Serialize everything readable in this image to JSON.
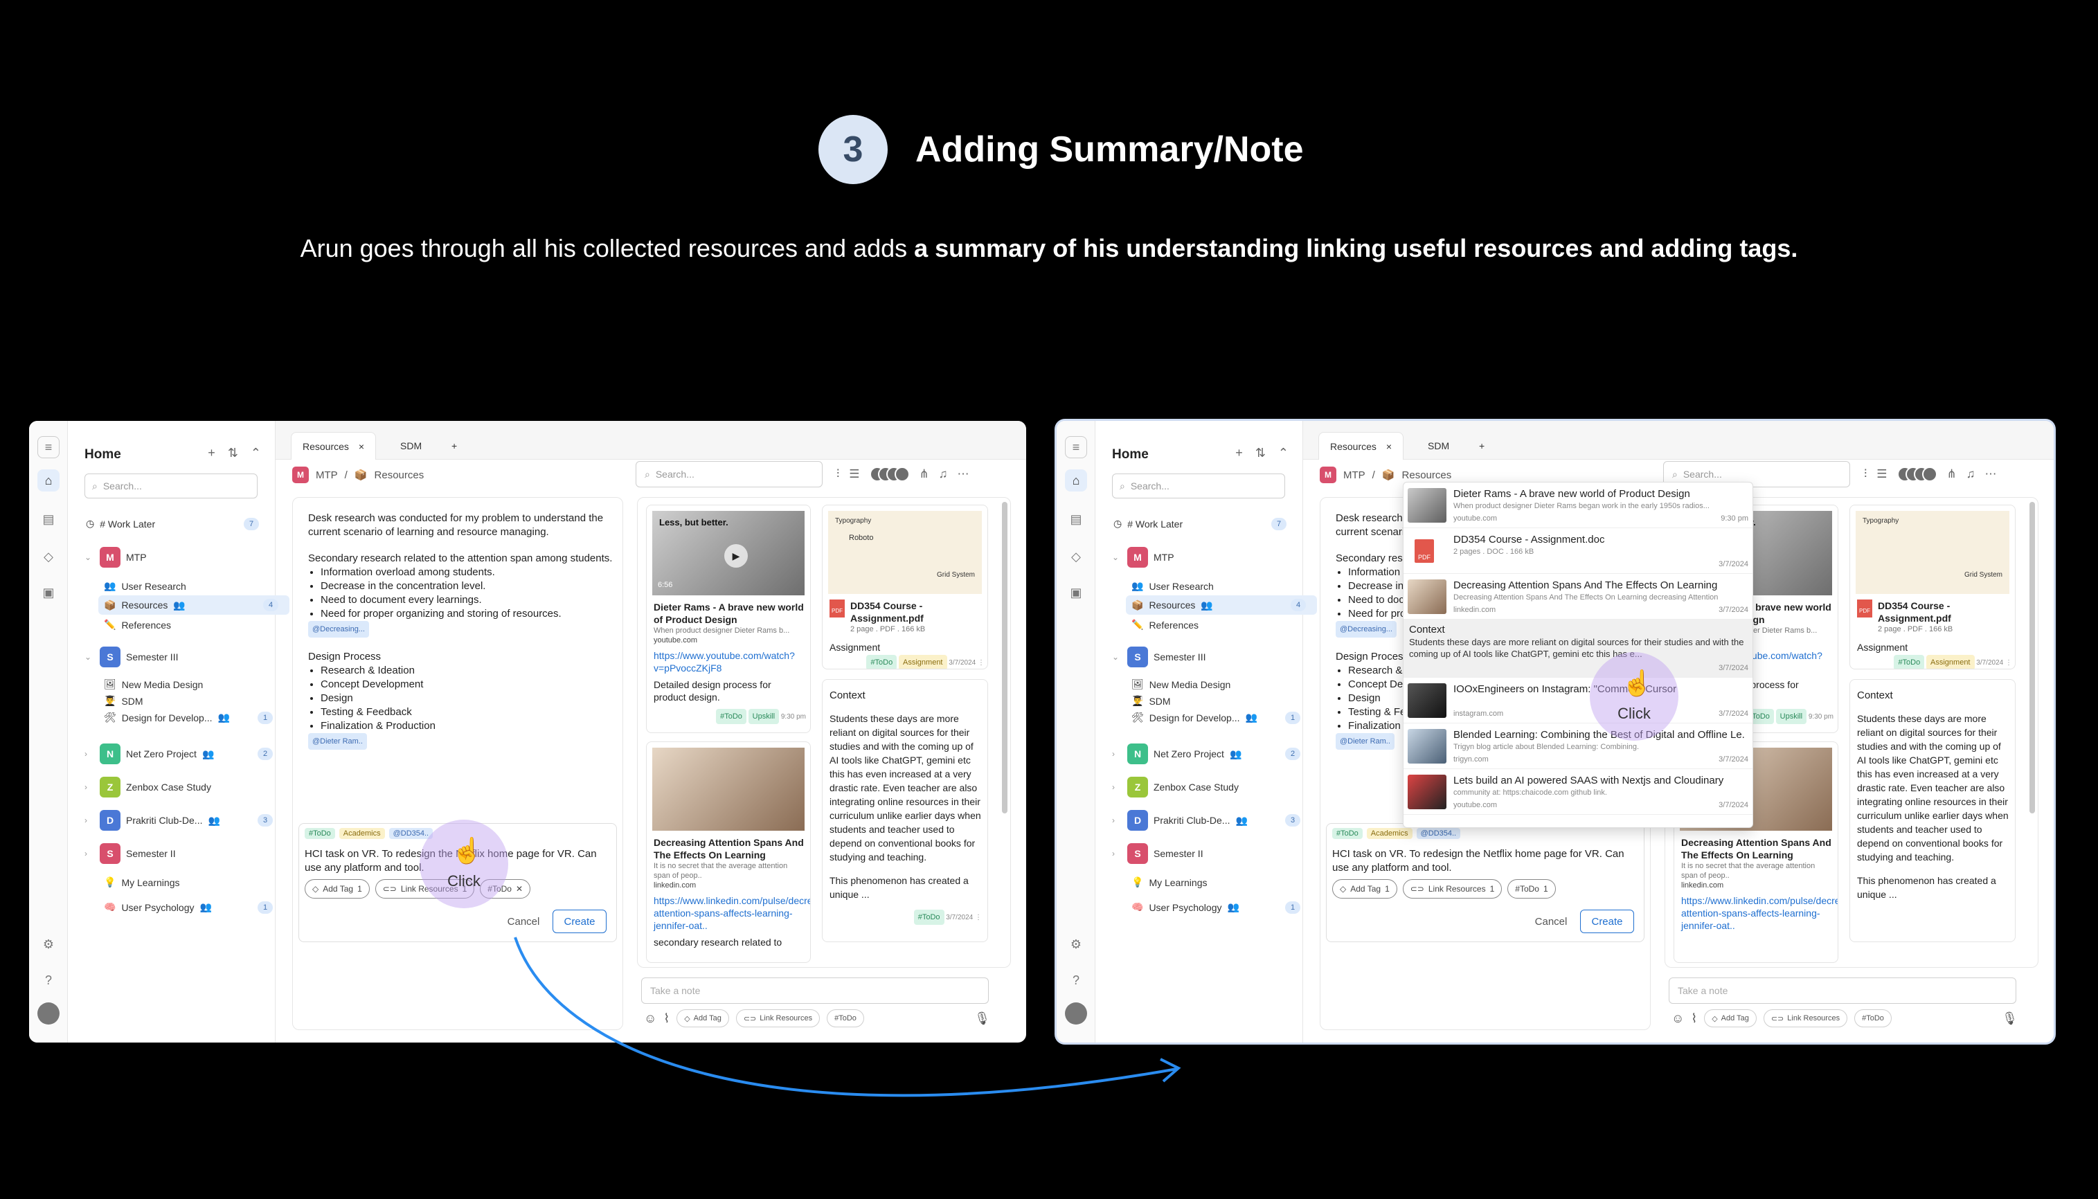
{
  "header": {
    "step_number": "3",
    "title": "Adding Summary/Note",
    "subtitle_plain": "Arun goes through all his collected resources and adds ",
    "subtitle_bold": "a summary of his understanding linking useful resources and adding tags."
  },
  "sidebar": {
    "title": "Home",
    "search_placeholder": "Search...",
    "work_later": "# Work Later",
    "work_later_count": "7",
    "mtp": {
      "label": "MTP",
      "avatar": "M"
    },
    "mtp_children": [
      {
        "label": "User Research",
        "icon": "👥"
      },
      {
        "label": "Resources",
        "icon": "📦",
        "count": "4"
      },
      {
        "label": "References",
        "icon": "✏️"
      }
    ],
    "sem3": {
      "label": "Semester III",
      "avatar": "S"
    },
    "sem3_children": [
      {
        "label": "New Media Design",
        "icon": "🖼"
      },
      {
        "label": "SDM",
        "icon": "👨‍🎓"
      },
      {
        "label": "Design for Develop...",
        "icon": "🛠",
        "count": "1"
      }
    ],
    "others": [
      {
        "label": "Net Zero Project",
        "avatar": "N",
        "count": "2"
      },
      {
        "label": "Zenbox Case Study",
        "avatar": "Z"
      },
      {
        "label": "Prakriti Club-De...",
        "avatar": "D",
        "count": "3"
      },
      {
        "label": "Semester II",
        "avatar": "S"
      }
    ],
    "my_learnings": "My Learnings",
    "user_psychology": "User Psychology",
    "user_psychology_count": "1"
  },
  "tabs": [
    {
      "label": "Resources"
    },
    {
      "label": "SDM"
    }
  ],
  "breadcrumb": {
    "root": "MTP",
    "sep": "/",
    "current": "Resources"
  },
  "top_search_placeholder": "Search...",
  "document": {
    "para1": "Desk research was conducted for my problem to understand the current scenario of learning and resource managing.",
    "para2": "Secondary research related to the attention span among students.",
    "bullets1": [
      "Information overload among students.",
      "Decrease in the concentration level.",
      "Need to document every learnings.",
      "Need for proper organizing and storing of resources."
    ],
    "mention1": "@Decreasing...",
    "heading2": "Design Process",
    "bullets2": [
      "Research & Ideation",
      "Concept Development",
      "Design",
      "Testing & Feedback",
      "Finalization & Production"
    ],
    "mention2": "@Dieter Ram..",
    "editor_tags": [
      "#ToDo",
      "Academics",
      "@DD354.."
    ],
    "editor_text": "HCI task on VR. To redesign the Netflix home page for VR. Can use any platform and tool.",
    "add_tag": "Add Tag",
    "add_tag_count": "1",
    "link_resources": "Link Resources",
    "link_resources_count": "1",
    "todo_pill": "#ToDo",
    "cancel": "Cancel",
    "create": "Create"
  },
  "cards": {
    "video": {
      "overlay": "Less, but better.",
      "duration": "6:56",
      "title": "Dieter Rams - A brave new world of Product Design",
      "desc": "When product designer Dieter Rams b...",
      "source": "youtube.com",
      "link": "https://www.youtube.com/watch?v=pPvoccZKjF8",
      "note": "Detailed design process for product design.",
      "tags": [
        "#ToDo",
        "Upskill"
      ],
      "time": "9:30 pm"
    },
    "pdf": {
      "thumb_label": "Typography",
      "thumb_font": "Roboto",
      "thumb_grid": "Grid System",
      "title": "DD354 Course - Assignment.pdf",
      "meta": "2 page . PDF . 166 kB",
      "note": "Assignment",
      "tags": [
        "#ToDo",
        "Assignment"
      ],
      "date": "3/7/2024"
    },
    "article": {
      "title": "Decreasing Attention Spans And The Effects On Learning",
      "desc": "It is no secret that the average attention span of peop..",
      "source": "linkedin.com",
      "link": "https://www.linkedin.com/pulse/decreasing-attention-spans-affects-learning-jennifer-oat..",
      "note": "secondary research related to"
    },
    "context": {
      "title": "Context",
      "body": "Students these days are more reliant on digital sources for their studies and with the coming up of AI tools like ChatGPT, gemini etc this has even increased at a very drastic rate. Even teacher are also integrating online resources in their curriculum unlike earlier days when students and teacher used to depend on conventional books for studying and teaching.",
      "body2": "This phenomenon has created a unique ...",
      "tag": "#ToDo",
      "date": "3/7/2024"
    }
  },
  "notebar": {
    "placeholder": "Take a note",
    "add_tag": "Add Tag",
    "link_resources": "Link Resources",
    "todo": "#ToDo"
  },
  "cursor_label": "Click",
  "dropdown": [
    {
      "title": "Dieter Rams - A brave new world of Product Design",
      "desc": "When product designer Dieter Rams began work in the early 1950s radios...",
      "source": "youtube.com",
      "time": "9:30 pm"
    },
    {
      "title": "DD354 Course - Assignment.doc",
      "desc": "2 pages . DOC . 166 kB",
      "source": "",
      "time": "3/7/2024"
    },
    {
      "title": "Decreasing Attention Spans And The Effects On Learning",
      "desc": "Decreasing Attention Spans And The Effects On Learning decreasing Attention",
      "source": "linkedin.com",
      "time": "3/7/2024"
    },
    {
      "title": "Context",
      "desc": "Students these days are more reliant on digital sources for their studies and with the coming up of AI tools like ChatGPT, gemini etc this has e...",
      "source": "",
      "time": "3/7/2024"
    },
    {
      "title": "IOOxEngineers on Instagram: \"Comment Cursor",
      "desc": "",
      "source": "instagram.com",
      "time": "3/7/2024"
    },
    {
      "title": "Blended Learning: Combining the Best of Digital and Offline Le...",
      "desc": "Trigyn blog article about Blended Learning: Combining.",
      "source": "trigyn.com",
      "time": "3/7/2024"
    },
    {
      "title": "Lets build an AI powered SAAS with Nextjs and Cloudinary",
      "desc": "community at: https:chaicode.com github link.",
      "source": "youtube.com",
      "time": "3/7/2024"
    }
  ],
  "colors": {
    "accent": "#1f6fd0",
    "arrow": "#2a8cf0",
    "mtp": "#d84f6c",
    "sem": "#4a78d6",
    "net": "#3dbf8a",
    "zen": "#9ac63a",
    "prak": "#4a78d6",
    "sem2": "#d84f6c"
  }
}
